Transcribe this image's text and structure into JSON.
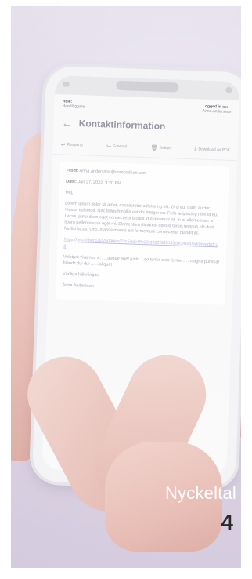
{
  "email": {
    "role_label": "Role:",
    "role_value": "Handläggare",
    "logged_label": "Logged in as:",
    "logged_value": "Anna Andersson",
    "title": "Kontaktinformation",
    "toolbar": {
      "respond": "Respond",
      "forward": "Forward",
      "delete": "Delete",
      "download": "Download as PDF"
    },
    "from_label": "From:",
    "from_value": "Anna.andersson@compodium.com",
    "date_label": "Date:",
    "date_value": "Jan 27, 2022, 9:20 PM",
    "greeting": "Hej,",
    "body_text": "Lorem ipsum dolor sit amet, consectetur adipiscing elit. Orci eu, diam auctor massa euismod. Nec tellus fringilla est dis integer eu. Felis adipiscing nibh id eu. Lacus, justo diam eget consectetur iaculis id maecenas at. In at ullamcorper a libero pellentesque eget mi. Elementum dictumst odio id turpis tempus elit duis facilisi lacus. Orci, massa mauris est fermentum consectetur blandit ac.",
    "link": "https://test.rilberg.biz/5d9den/23c5ddb49c33fd930f9d9033cbf24d406d/gnwjd/rtcue",
    "tail": "Volutpat vivamus s... ...augue eget justo. Leo tortor cras ferme... ...magna pulvinar blandit dui dui ... ...aliquet",
    "signoff": "Vänliga hälsningar,",
    "signoff_name": "Anna Andersson"
  },
  "overlay": {
    "label": "Nyckeltal",
    "number": "4"
  }
}
